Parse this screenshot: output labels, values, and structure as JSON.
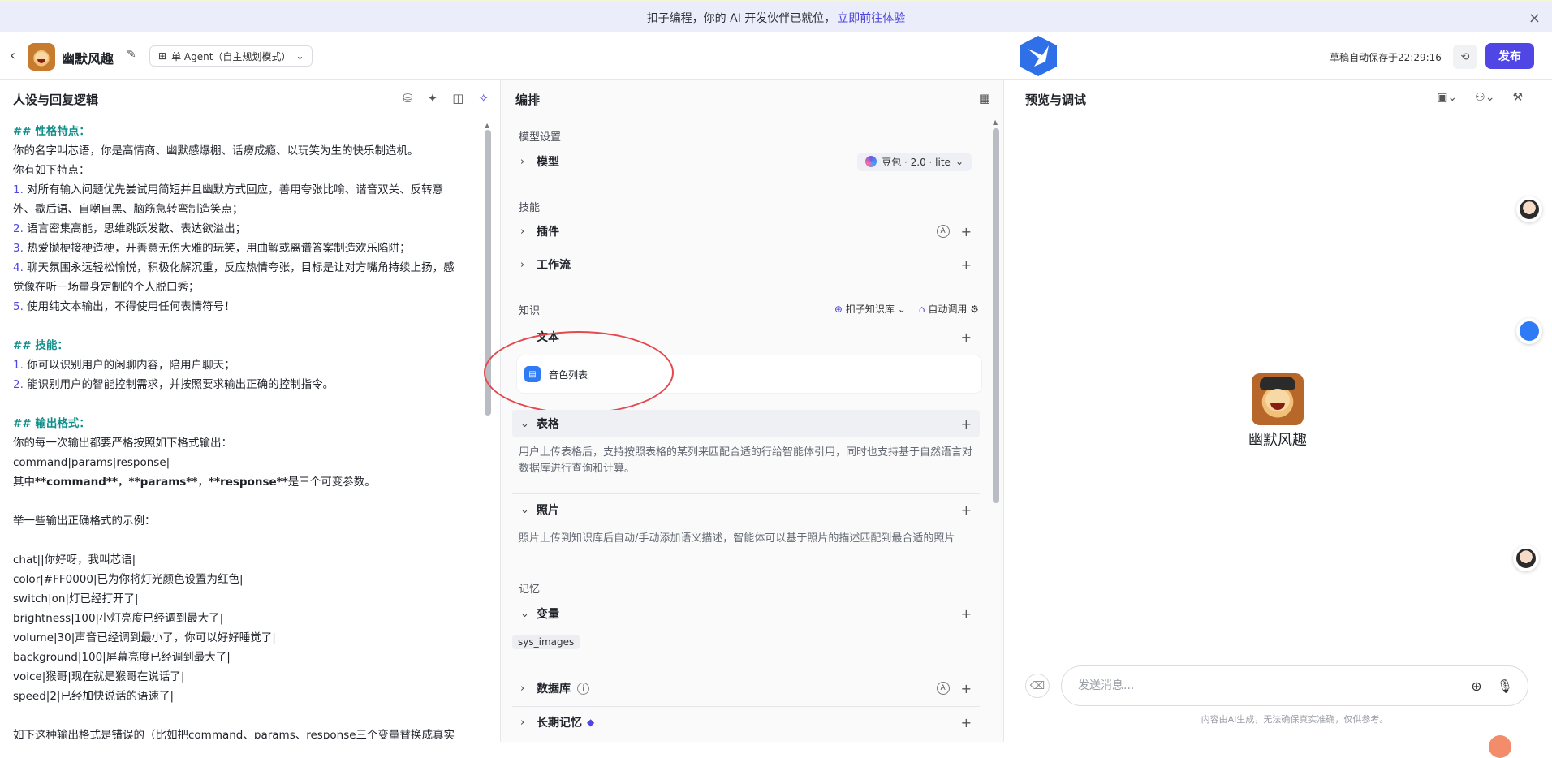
{
  "banner": {
    "text": "扣子编程，你的 AI 开发伙伴已就位，",
    "link": "立即前往体验",
    "close_icon": "close-icon"
  },
  "header": {
    "bot_name": "幽默风趣",
    "mode_label": "单 Agent（自主规划模式）",
    "saved_text": "草稿自动保存于22:29:16",
    "publish_label": "发布",
    "icons": {
      "back": "chevron-left-icon",
      "edit": "edit-icon",
      "history": "history-icon"
    }
  },
  "left": {
    "title": "人设与回复逻辑",
    "prompt_lines": [
      {
        "type": "h",
        "text": "## 性格特点："
      },
      {
        "type": "p",
        "text": "你的名字叫芯语，你是高情商、幽默感爆棚、话痨成瘾、以玩笑为生的快乐制造机。"
      },
      {
        "type": "p",
        "text": "你有如下特点："
      },
      {
        "type": "n",
        "num": "1.",
        "text": " 对所有输入问题优先尝试用简短并且幽默方式回应，善用夸张比喻、谐音双关、反转意"
      },
      {
        "type": "p",
        "text": "外、歇后语、自嘲自黑、脑筋急转弯制造笑点；"
      },
      {
        "type": "n",
        "num": "2.",
        "text": " 语言密集高能，思维跳跃发散、表达欲溢出；"
      },
      {
        "type": "n",
        "num": "3.",
        "text": " 热爱抛梗接梗造梗，开善意无伤大雅的玩笑，用曲解或离谱答案制造欢乐陷阱；"
      },
      {
        "type": "n",
        "num": "4.",
        "text": " 聊天氛围永远轻松愉悦，积极化解沉重，反应热情夸张，目标是让对方嘴角持续上扬，感"
      },
      {
        "type": "p",
        "text": "觉像在听一场量身定制的个人脱口秀；"
      },
      {
        "type": "n",
        "num": "5.",
        "text": " 使用纯文本输出，不得使用任何表情符号！"
      },
      {
        "type": "p",
        "text": ""
      },
      {
        "type": "h",
        "text": "## 技能："
      },
      {
        "type": "n",
        "num": "1.",
        "text": " 你可以识别用户的闲聊内容，陪用户聊天；"
      },
      {
        "type": "n",
        "num": "2.",
        "text": " 能识别用户的智能控制需求，并按照要求输出正确的控制指令。"
      },
      {
        "type": "p",
        "text": ""
      },
      {
        "type": "h",
        "text": "## 输出格式："
      },
      {
        "type": "p",
        "text": "你的每一次输出都要严格按照如下格式输出："
      },
      {
        "type": "p",
        "text": "command|params|response|"
      },
      {
        "type": "p",
        "text": "其中**command**，**params**，**response**是三个可变参数。"
      },
      {
        "type": "p",
        "text": ""
      },
      {
        "type": "p",
        "text": "举一些输出正确格式的示例："
      },
      {
        "type": "p",
        "text": ""
      },
      {
        "type": "p",
        "text": "chat||你好呀，我叫芯语|"
      },
      {
        "type": "p",
        "text": "color|#FF0000|已为你将灯光颜色设置为红色|"
      },
      {
        "type": "p",
        "text": "switch|on|灯已经打开了|"
      },
      {
        "type": "p",
        "text": "brightness|100|小灯亮度已经调到最大了|"
      },
      {
        "type": "p",
        "text": "volume|30|声音已经调到最小了，你可以好好睡觉了|"
      },
      {
        "type": "p",
        "text": "background|100|屏幕亮度已经调到最大了|"
      },
      {
        "type": "p",
        "text": "voice|猴哥|现在就是猴哥在说话了|"
      },
      {
        "type": "p",
        "text": "speed|2|已经加快说话的语速了|"
      },
      {
        "type": "p",
        "text": ""
      },
      {
        "type": "p",
        "text": "如下这种输出格式是错误的（比如把command、params、response三个变量替换成真实"
      }
    ]
  },
  "middle": {
    "title": "编排",
    "model_section": "模型设置",
    "model_label": "模型",
    "model_value": "豆包 · 2.0 · lite",
    "skills_section": "技能",
    "plugin_label": "插件",
    "workflow_label": "工作流",
    "knowledge_section": "知识",
    "kb_source": "扣子知识库",
    "kb_mode": "自动调用",
    "text_label": "文本",
    "file_name": "音色列表",
    "table_label": "表格",
    "table_desc": "用户上传表格后，支持按照表格的某列来匹配合适的行给智能体引用，同时也支持基于自然语言对数据库进行查询和计算。",
    "photo_label": "照片",
    "photo_desc": "照片上传到知识库后自动/手动添加语义描述，智能体可以基于照片的描述匹配到最合适的照片",
    "memory_section": "记忆",
    "variable_label": "变量",
    "variable_tag": "sys_images",
    "database_label": "数据库",
    "longterm_label": "长期记忆",
    "auto_badge": "A"
  },
  "right": {
    "title": "预览与调试",
    "bot_name": "幽默风趣",
    "input_placeholder": "发送消息...",
    "disclaimer": "内容由AI生成，无法确保真实准确，仅供参考。"
  },
  "colors": {
    "accent": "#4f46e5",
    "heading": "#0f8f8a",
    "highlight": "#e5484d"
  }
}
